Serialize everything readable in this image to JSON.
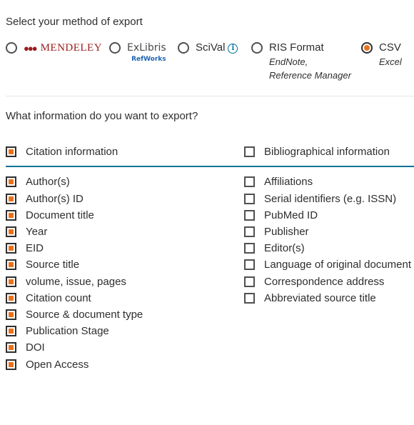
{
  "export_method": {
    "heading": "Select your method of export",
    "options": [
      {
        "id": "mendeley",
        "label": "MENDELEY",
        "selected": false
      },
      {
        "id": "refworks",
        "label_top": "ExLibris",
        "label_bottom": "RefWorks",
        "selected": false
      },
      {
        "id": "scival",
        "label": "SciVal",
        "info_icon": "info-icon",
        "selected": false
      },
      {
        "id": "ris",
        "label": "RIS Format",
        "sub": [
          "EndNote,",
          "Reference Manager"
        ],
        "selected": false
      },
      {
        "id": "csv",
        "label": "CSV",
        "sub": [
          "Excel"
        ],
        "selected": true
      }
    ]
  },
  "export_info": {
    "heading": "What information do you want to export?",
    "groups": {
      "citation": {
        "label": "Citation information",
        "checked": true
      },
      "bibliographical": {
        "label": "Bibliographical information",
        "checked": false
      }
    },
    "citation_fields": [
      {
        "label": "Author(s)",
        "checked": true
      },
      {
        "label": "Author(s) ID",
        "checked": true
      },
      {
        "label": "Document title",
        "checked": true
      },
      {
        "label": "Year",
        "checked": true
      },
      {
        "label": "EID",
        "checked": true
      },
      {
        "label": "Source title",
        "checked": true
      },
      {
        "label": "volume, issue, pages",
        "checked": true
      },
      {
        "label": "Citation count",
        "checked": true
      },
      {
        "label": "Source & document type",
        "checked": true
      },
      {
        "label": "Publication Stage",
        "checked": true
      },
      {
        "label": "DOI",
        "checked": true
      },
      {
        "label": "Open Access",
        "checked": true
      }
    ],
    "bibliographical_fields": [
      {
        "label": "Affiliations",
        "checked": false
      },
      {
        "label": "Serial identifiers (e.g. ISSN)",
        "checked": false
      },
      {
        "label": "PubMed ID",
        "checked": false
      },
      {
        "label": "Publisher",
        "checked": false
      },
      {
        "label": "Editor(s)",
        "checked": false
      },
      {
        "label": "Language of original document",
        "checked": false
      },
      {
        "label": "Correspondence address",
        "checked": false
      },
      {
        "label": "Abbreviated source title",
        "checked": false
      }
    ]
  },
  "colors": {
    "accent": "#e9711c",
    "rule": "#007398",
    "mendeley": "#9c1b1b",
    "refworks": "#1f63b1"
  }
}
